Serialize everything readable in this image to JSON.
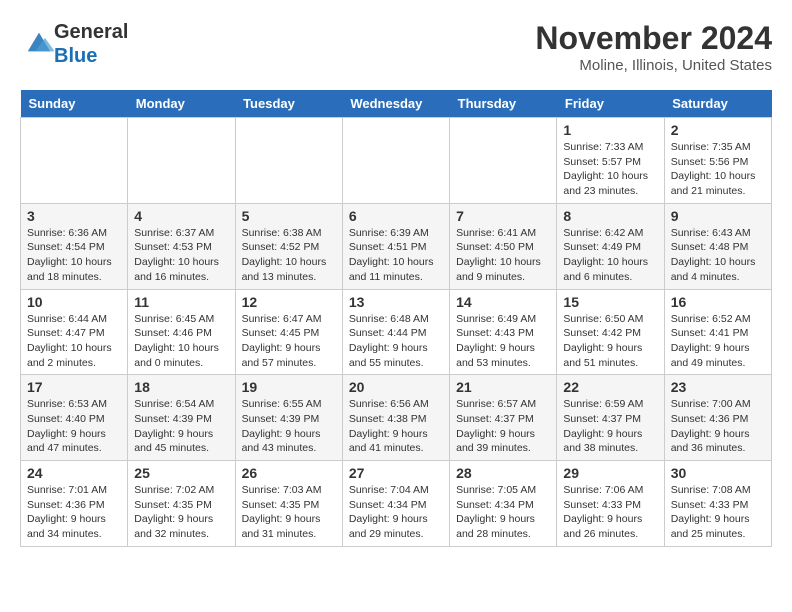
{
  "logo": {
    "general": "General",
    "blue": "Blue"
  },
  "title": "November 2024",
  "subtitle": "Moline, Illinois, United States",
  "days_of_week": [
    "Sunday",
    "Monday",
    "Tuesday",
    "Wednesday",
    "Thursday",
    "Friday",
    "Saturday"
  ],
  "weeks": [
    [
      {
        "day": "",
        "details": ""
      },
      {
        "day": "",
        "details": ""
      },
      {
        "day": "",
        "details": ""
      },
      {
        "day": "",
        "details": ""
      },
      {
        "day": "",
        "details": ""
      },
      {
        "day": "1",
        "details": "Sunrise: 7:33 AM\nSunset: 5:57 PM\nDaylight: 10 hours and 23 minutes."
      },
      {
        "day": "2",
        "details": "Sunrise: 7:35 AM\nSunset: 5:56 PM\nDaylight: 10 hours and 21 minutes."
      }
    ],
    [
      {
        "day": "3",
        "details": "Sunrise: 6:36 AM\nSunset: 4:54 PM\nDaylight: 10 hours and 18 minutes."
      },
      {
        "day": "4",
        "details": "Sunrise: 6:37 AM\nSunset: 4:53 PM\nDaylight: 10 hours and 16 minutes."
      },
      {
        "day": "5",
        "details": "Sunrise: 6:38 AM\nSunset: 4:52 PM\nDaylight: 10 hours and 13 minutes."
      },
      {
        "day": "6",
        "details": "Sunrise: 6:39 AM\nSunset: 4:51 PM\nDaylight: 10 hours and 11 minutes."
      },
      {
        "day": "7",
        "details": "Sunrise: 6:41 AM\nSunset: 4:50 PM\nDaylight: 10 hours and 9 minutes."
      },
      {
        "day": "8",
        "details": "Sunrise: 6:42 AM\nSunset: 4:49 PM\nDaylight: 10 hours and 6 minutes."
      },
      {
        "day": "9",
        "details": "Sunrise: 6:43 AM\nSunset: 4:48 PM\nDaylight: 10 hours and 4 minutes."
      }
    ],
    [
      {
        "day": "10",
        "details": "Sunrise: 6:44 AM\nSunset: 4:47 PM\nDaylight: 10 hours and 2 minutes."
      },
      {
        "day": "11",
        "details": "Sunrise: 6:45 AM\nSunset: 4:46 PM\nDaylight: 10 hours and 0 minutes."
      },
      {
        "day": "12",
        "details": "Sunrise: 6:47 AM\nSunset: 4:45 PM\nDaylight: 9 hours and 57 minutes."
      },
      {
        "day": "13",
        "details": "Sunrise: 6:48 AM\nSunset: 4:44 PM\nDaylight: 9 hours and 55 minutes."
      },
      {
        "day": "14",
        "details": "Sunrise: 6:49 AM\nSunset: 4:43 PM\nDaylight: 9 hours and 53 minutes."
      },
      {
        "day": "15",
        "details": "Sunrise: 6:50 AM\nSunset: 4:42 PM\nDaylight: 9 hours and 51 minutes."
      },
      {
        "day": "16",
        "details": "Sunrise: 6:52 AM\nSunset: 4:41 PM\nDaylight: 9 hours and 49 minutes."
      }
    ],
    [
      {
        "day": "17",
        "details": "Sunrise: 6:53 AM\nSunset: 4:40 PM\nDaylight: 9 hours and 47 minutes."
      },
      {
        "day": "18",
        "details": "Sunrise: 6:54 AM\nSunset: 4:39 PM\nDaylight: 9 hours and 45 minutes."
      },
      {
        "day": "19",
        "details": "Sunrise: 6:55 AM\nSunset: 4:39 PM\nDaylight: 9 hours and 43 minutes."
      },
      {
        "day": "20",
        "details": "Sunrise: 6:56 AM\nSunset: 4:38 PM\nDaylight: 9 hours and 41 minutes."
      },
      {
        "day": "21",
        "details": "Sunrise: 6:57 AM\nSunset: 4:37 PM\nDaylight: 9 hours and 39 minutes."
      },
      {
        "day": "22",
        "details": "Sunrise: 6:59 AM\nSunset: 4:37 PM\nDaylight: 9 hours and 38 minutes."
      },
      {
        "day": "23",
        "details": "Sunrise: 7:00 AM\nSunset: 4:36 PM\nDaylight: 9 hours and 36 minutes."
      }
    ],
    [
      {
        "day": "24",
        "details": "Sunrise: 7:01 AM\nSunset: 4:36 PM\nDaylight: 9 hours and 34 minutes."
      },
      {
        "day": "25",
        "details": "Sunrise: 7:02 AM\nSunset: 4:35 PM\nDaylight: 9 hours and 32 minutes."
      },
      {
        "day": "26",
        "details": "Sunrise: 7:03 AM\nSunset: 4:35 PM\nDaylight: 9 hours and 31 minutes."
      },
      {
        "day": "27",
        "details": "Sunrise: 7:04 AM\nSunset: 4:34 PM\nDaylight: 9 hours and 29 minutes."
      },
      {
        "day": "28",
        "details": "Sunrise: 7:05 AM\nSunset: 4:34 PM\nDaylight: 9 hours and 28 minutes."
      },
      {
        "day": "29",
        "details": "Sunrise: 7:06 AM\nSunset: 4:33 PM\nDaylight: 9 hours and 26 minutes."
      },
      {
        "day": "30",
        "details": "Sunrise: 7:08 AM\nSunset: 4:33 PM\nDaylight: 9 hours and 25 minutes."
      }
    ]
  ]
}
